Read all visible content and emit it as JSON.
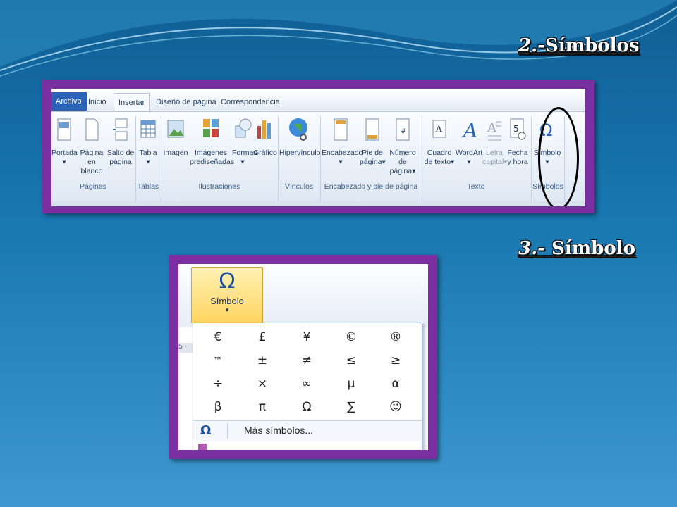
{
  "headings": {
    "step2_number": "2.-",
    "step2_label": "Símbolos",
    "step3_number": "3.-",
    "step3_label": "Símbolo"
  },
  "ribbon": {
    "tabs": [
      "Archivo",
      "Inicio",
      "Insertar",
      "Diseño de página",
      "Correspondencia"
    ],
    "active_tab": "Insertar",
    "buttons": {
      "portada": "Portada",
      "pagina_blanco_1": "Página",
      "pagina_blanco_2": "en blanco",
      "salto_1": "Salto de",
      "salto_2": "página",
      "tabla": "Tabla",
      "imagen": "Imagen",
      "imagenes_1": "Imágenes",
      "imagenes_2": "prediseñadas",
      "formas": "Formas",
      "grafico": "Gráfico",
      "hipervinculo": "Hipervínculo",
      "encabezado": "Encabezado",
      "pie_1": "Pie de",
      "pie_2": "página",
      "numero_1": "Número de",
      "numero_2": "página",
      "cuadro_1": "Cuadro",
      "cuadro_2": "de texto",
      "wordart": "WordArt",
      "letra_1": "Letra",
      "letra_2": "capital",
      "fecha_1": "Fecha",
      "fecha_2": "y hora",
      "simbolo": "Símbolo"
    },
    "groups": {
      "paginas": "Páginas",
      "tablas": "Tablas",
      "ilustraciones": "Ilustraciones",
      "vinculos": "Vínculos",
      "encabezado": "Encabezado y pie de página",
      "texto": "Texto",
      "simbolos": "Símbolos"
    }
  },
  "symbol_dropdown": {
    "button_label": "Símbolo",
    "symbols": [
      "€",
      "£",
      "¥",
      "©",
      "®",
      "™",
      "±",
      "≠",
      "≤",
      "≥",
      "÷",
      "×",
      "∞",
      "µ",
      "α",
      "β",
      "π",
      "Ω",
      "∑",
      "☺"
    ],
    "more_symbols": "Más símbolos..."
  },
  "colors": {
    "frame": "#7a2fa0",
    "file_tab": "#2a63b6",
    "symbol_button": "#ffd560"
  }
}
